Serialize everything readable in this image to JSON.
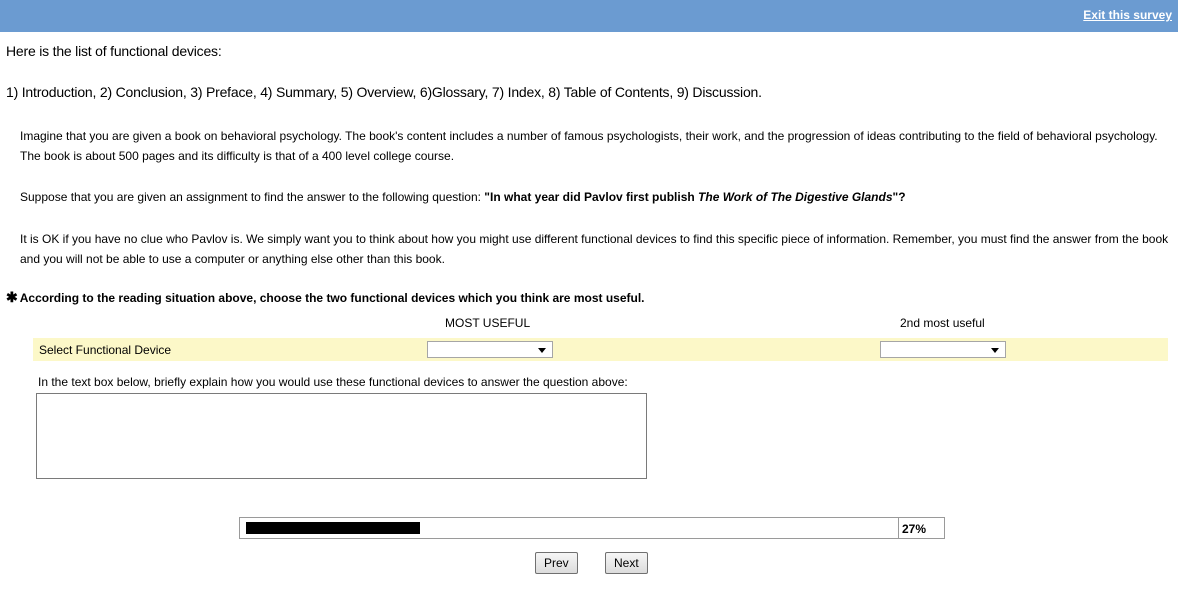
{
  "header": {
    "exit_link": "Exit this survey",
    "bar_color": "#6b9bd1"
  },
  "intro": {
    "line1": "Here is the list of functional devices:",
    "line2": "1) Introduction, 2) Conclusion, 3) Preface, 4) Summary, 5) Overview, 6)Glossary, 7) Index, 8) Table of Contents, 9) Discussion."
  },
  "scenario": {
    "para1": "Imagine that you are given a book on behavioral psychology. The book's content includes a number of famous psychologists, their work, and the progression of ideas contributing to the field of behavioral psychology. The book is about 500 pages and its difficulty is that of a 400 level college course.",
    "para2_prefix": "Suppose that you are given an assignment to find the answer to the following question: ",
    "para2_bold_start": "\"In what year did Pavlov first publish ",
    "para2_bold_italic": "The Work of The Digestive Glands",
    "para2_bold_end": "\"?",
    "para3": "It is OK if you have no clue who Pavlov is. We simply want you to think about how you might use different functional devices to find this specific piece of information. Remember, you must find the answer from the book and you will not be able to use a computer or anything else other than this book."
  },
  "question": {
    "required_marker": "✱",
    "text": "According to the reading situation above, choose the two functional devices which you think are most useful."
  },
  "columns": {
    "first": "MOST USEFUL",
    "second": "2nd most useful"
  },
  "select_row": {
    "label": "Select Functional Device",
    "first_value": "",
    "second_value": "",
    "row_color": "#fcf8c8"
  },
  "explain": {
    "label": "In the text box below, briefly explain how you would use these functional devices to answer the question above:",
    "value": ""
  },
  "progress": {
    "percent": 27,
    "label": "27%"
  },
  "nav": {
    "prev": "Prev",
    "next": "Next"
  }
}
